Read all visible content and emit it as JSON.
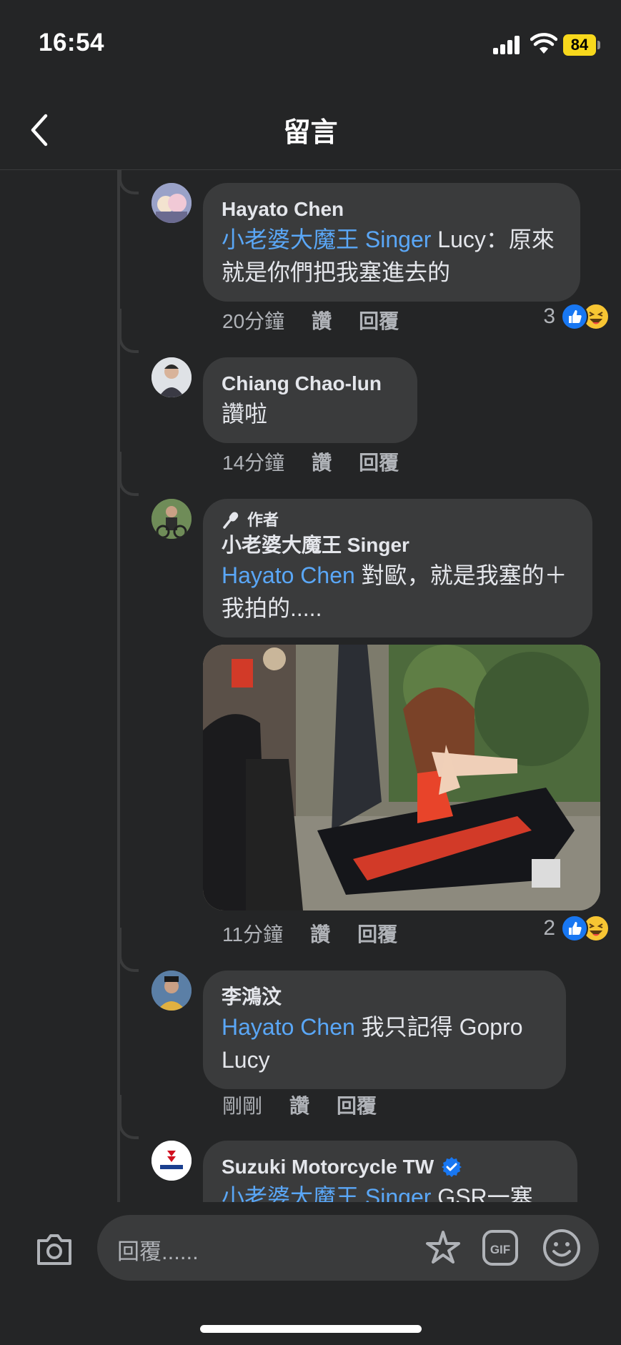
{
  "status_bar": {
    "time": "16:54",
    "battery": "84"
  },
  "header": {
    "title": "留言"
  },
  "comments": [
    {
      "name": "Hayato Chen",
      "mention": "小老婆大魔王 Singer",
      "text": " Lucy：原來就是你們把我塞進去的",
      "time": "20分鐘",
      "like": "讚",
      "reply": "回覆",
      "reaction_count": "3"
    },
    {
      "name": "Chiang Chao-lun",
      "text": "讚啦",
      "time": "14分鐘",
      "like": "讚",
      "reply": "回覆"
    },
    {
      "badge": "作者",
      "name": "小老婆大魔王 Singer",
      "mention": "Hayato Chen",
      "text": " 對歐，就是我塞的＋我拍的.....",
      "time": "11分鐘",
      "like": "讚",
      "reply": "回覆",
      "reaction_count": "2"
    },
    {
      "name": "李鴻汶",
      "mention": "Hayato Chen",
      "text": " 我只記得 Gopro Lucy",
      "time": "剛剛",
      "like": "讚",
      "reply": "回覆"
    },
    {
      "name": "Suzuki Motorcycle TW",
      "mention": "小老婆大魔王 Singer",
      "text": " GSR一塞"
    }
  ],
  "composer": {
    "placeholder": "回覆......"
  },
  "colors": {
    "background": "#242526",
    "bubble": "#3a3b3c",
    "mention": "#5aa7f7",
    "like": "#1877f2",
    "battery": "#f7d81c"
  }
}
